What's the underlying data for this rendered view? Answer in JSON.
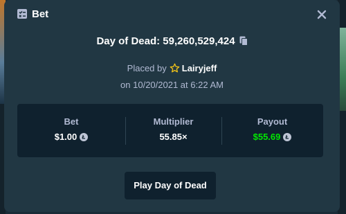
{
  "modal": {
    "title": "Bet",
    "header_icon": "bet-slip-icon",
    "close_icon": "close-icon"
  },
  "bet": {
    "game_label": "Day of Dead: 59,260,529,424",
    "copy_icon": "copy-icon",
    "placed_by_prefix": "Placed by",
    "vip_icon": "star-icon",
    "username": "Lairyjeff",
    "date_text": "on 10/20/2021 at 6:22 AM"
  },
  "stats": {
    "bet_label": "Bet",
    "bet_value": "$1.00",
    "multiplier_label": "Multiplier",
    "multiplier_value": "55.85×",
    "payout_label": "Payout",
    "payout_value": "$55.69",
    "currency_icon": "litecoin-icon"
  },
  "actions": {
    "play_label": "Play Day of Dead"
  },
  "colors": {
    "modal_bg": "#213743",
    "panel_bg": "#0f212e",
    "muted_text": "#b1bad3",
    "payout_green": "#00e701",
    "star_gold": "#f5c518"
  }
}
